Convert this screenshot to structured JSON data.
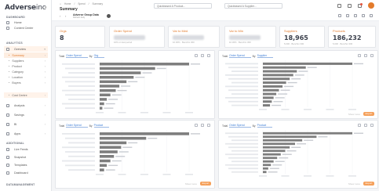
{
  "app": {
    "logo_main": "Adverse",
    "logo_suffix": "inc",
    "logo_caret": "▾"
  },
  "sidebar": {
    "sections": [
      {
        "title": "DASHBOARD"
      },
      {
        "title": "ANALYTICS"
      },
      {
        "title": "ADDITIONAL"
      },
      {
        "title": "DATAMANAGEMENT"
      }
    ],
    "dashboard_items": [
      "Home",
      "Content Center"
    ],
    "analytics_root": "Overview",
    "analytics_children": [
      "Summary",
      "Suppliers",
      "Product",
      "Category",
      "Location",
      "Buyers",
      "Cost Centre"
    ],
    "analytics_more": [
      "Analysis",
      "Savings",
      "BI",
      "Apps"
    ],
    "additional_items": [
      "Live Feeds",
      "Snapshot",
      "Templates",
      "Dashboard"
    ]
  },
  "topbar": {
    "crumbs": [
      "Home",
      "Spend",
      "Summary"
    ],
    "title": "Summary",
    "search1_placeholder": "Quickbased A Product...",
    "search2_placeholder": "Quickbased A Supplier..."
  },
  "subbar": {
    "report_name": "Adverse Group Data",
    "report_sub": "Refresh daily"
  },
  "kpis": [
    {
      "label": "Orgs",
      "value": "8",
      "sub": ""
    },
    {
      "label": "Order Spend",
      "value": "",
      "sub": "10% on last period"
    },
    {
      "label": "Var to Med",
      "value": "",
      "sub": "10.30% · Benchm 300"
    },
    {
      "label": "Var to Min",
      "value": "",
      "sub": "10.30% · Benchm 300"
    },
    {
      "label": "Suppliers",
      "value": "18,965",
      "sub": "5,000 · Benchm 300"
    },
    {
      "label": "Products",
      "value": "186,232",
      "sub": "5,000 · Benchm 300"
    }
  ],
  "panels": [
    {
      "metric_label": "Total",
      "metric": "Order Spend",
      "by_label": "By",
      "by": "Org"
    },
    {
      "metric_label": "Total",
      "metric": "Order Spend",
      "by_label": "By",
      "by": "Supplier"
    },
    {
      "metric_label": "Total",
      "metric": "Order Spend",
      "by_label": "By",
      "by": "Product"
    },
    {
      "metric_label": "Total",
      "metric": "Order Spend",
      "by_label": "By",
      "by": "Product"
    }
  ],
  "panel_footer": {
    "link": "Show more",
    "button": "Export"
  },
  "chart_data": [
    {
      "type": "bar",
      "orientation": "horizontal",
      "values": [
        100,
        62,
        46,
        38,
        30,
        22,
        18,
        12,
        8,
        5,
        3
      ]
    },
    {
      "type": "bar",
      "orientation": "horizontal",
      "values": [
        100,
        48,
        38,
        34,
        30,
        26,
        22,
        18,
        15,
        12,
        10,
        8
      ]
    },
    {
      "type": "bar",
      "orientation": "horizontal",
      "values": [
        100,
        52,
        30,
        24,
        20,
        16,
        12,
        8,
        5
      ]
    },
    {
      "type": "bar",
      "orientation": "horizontal",
      "values": [
        100,
        60,
        44,
        36,
        30,
        25,
        20,
        16,
        12,
        9,
        6,
        4
      ]
    }
  ],
  "colors": {
    "accent": "#e37b2c",
    "bar": "#7d7d7d",
    "link": "#3a7bd5"
  }
}
